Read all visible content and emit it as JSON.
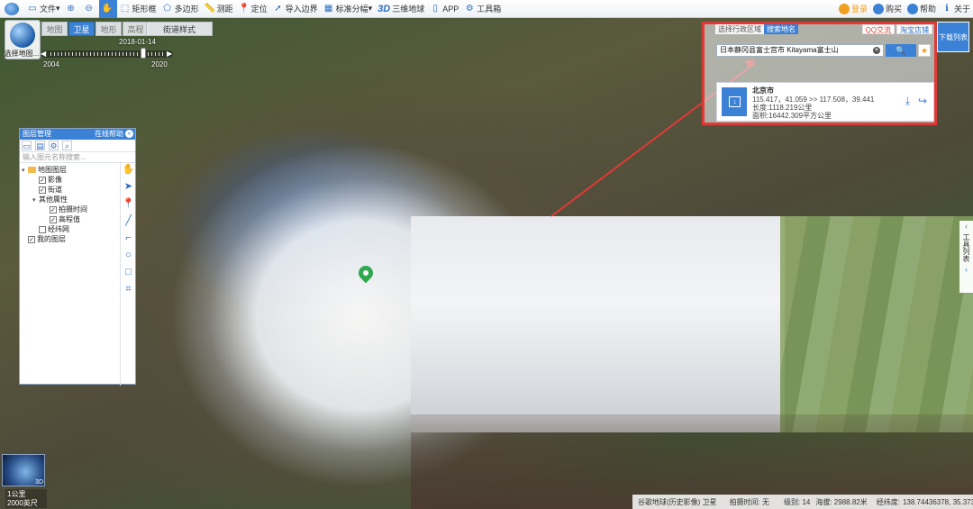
{
  "toolbar": {
    "items": [
      {
        "label": "文件",
        "icon": "folder-icon",
        "caret": true
      },
      {
        "label": "",
        "icon": "zoom-in-icon"
      },
      {
        "label": "",
        "icon": "zoom-out-icon"
      },
      {
        "label": "",
        "icon": "hand-pan-icon",
        "active": true
      },
      {
        "label": "矩形框",
        "icon": "rectangle-icon"
      },
      {
        "label": "多边形",
        "icon": "polygon-icon"
      },
      {
        "label": "测距",
        "icon": "ruler-icon"
      },
      {
        "label": "定位",
        "icon": "location-icon"
      },
      {
        "label": "导入边界",
        "icon": "import-icon"
      },
      {
        "label": "标准分幅",
        "icon": "grid-icon",
        "caret": true
      },
      {
        "label": "三维地球",
        "icon": "3d-globe-icon",
        "prefix": "3D"
      },
      {
        "label": "APP",
        "icon": "phone-icon"
      },
      {
        "label": "工具箱",
        "icon": "gear-icon"
      }
    ],
    "right": [
      {
        "label": "登录",
        "icon": "diamond-icon",
        "color": "#f0a020"
      },
      {
        "label": "购买",
        "icon": "vip-icon",
        "color": "#3b82d6"
      },
      {
        "label": "帮助",
        "icon": "help-icon",
        "color": "#3b82d6"
      },
      {
        "label": "关于",
        "icon": "info-icon",
        "color": "#3b82d6"
      }
    ]
  },
  "map_selector": {
    "label": "选择地图..."
  },
  "map_tabs": [
    {
      "label": "地图",
      "active": false
    },
    {
      "label": "卫星",
      "active": true
    },
    {
      "label": "地形",
      "active": false
    },
    {
      "label": "高程",
      "active": false
    }
  ],
  "street_style": "街道样式",
  "timeline": {
    "current_date": "2018-01-14",
    "start_year": "2004",
    "end_year": "2020",
    "level": 0.86
  },
  "layer_panel": {
    "title": "图层管理",
    "help": "在线帮助",
    "search_placeholder": "输入图元名称搜索...",
    "tree": [
      {
        "label": "地图图层",
        "depth": 0,
        "toggle": "▾",
        "folder": true,
        "checkbox": false
      },
      {
        "label": "影像",
        "depth": 1,
        "checkbox": true,
        "checked": true
      },
      {
        "label": "街道",
        "depth": 1,
        "checkbox": true,
        "checked": true
      },
      {
        "label": "其他属性",
        "depth": 1,
        "toggle": "▾",
        "checkbox": false
      },
      {
        "label": "拍摄时间",
        "depth": 2,
        "checkbox": true,
        "checked": true
      },
      {
        "label": "高程值",
        "depth": 2,
        "checkbox": true,
        "checked": true
      },
      {
        "label": "经纬网",
        "depth": 1,
        "checkbox": true,
        "checked": false
      },
      {
        "label": "我的图层",
        "depth": 0,
        "checkbox": true,
        "checked": true
      }
    ],
    "draw_tools": [
      "hand-icon",
      "pointer-icon",
      "pin-icon",
      "line-icon",
      "polyline-icon",
      "circle-icon",
      "square-icon",
      "tag-icon"
    ]
  },
  "search": {
    "tabs": [
      {
        "label": "选择行政区域",
        "active": false
      },
      {
        "label": "搜索地名",
        "active": true
      }
    ],
    "links": [
      {
        "label": "QQ交流",
        "color": "#e0463a"
      },
      {
        "label": "淘宝店铺",
        "color": "#2c6fc4"
      }
    ],
    "query": "日本静冈县富士宫市 Kitayama富士山",
    "search_button": "🔍",
    "result": {
      "name": "北京市",
      "coords": "115.417，41.059 >> 117.508，39.441",
      "length": "长度:1118.219公里",
      "area": "面积:16442.309平方公里"
    }
  },
  "download_list": "下载列表",
  "tool_list": "工具列表",
  "scale": {
    "line1": "1公里",
    "line2": "2000英尺"
  },
  "status": {
    "source": "谷歌地球(历史影像) 卫星",
    "capture_time": "拍摄时间: 无",
    "level": "级别: 14",
    "altitude": "海拔: 2988.82米",
    "coords_label": "经纬度:",
    "coords": "138.74436378, 35.37340164"
  }
}
